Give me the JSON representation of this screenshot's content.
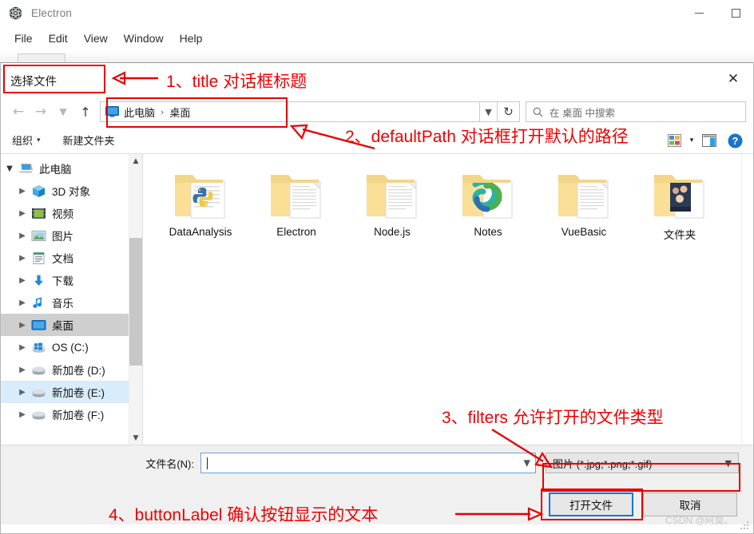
{
  "host_window": {
    "title": "Electron",
    "logo_icon": "electron-atom-icon",
    "menu": [
      {
        "label": "File"
      },
      {
        "label": "Edit"
      },
      {
        "label": "View"
      },
      {
        "label": "Window"
      },
      {
        "label": "Help"
      }
    ],
    "controls": {
      "minimize_icon": "minimize-icon",
      "maximize_icon": "maximize-icon"
    }
  },
  "dialog": {
    "title": "选择文件",
    "close_icon": "close-icon",
    "nav": {
      "back_icon": "arrow-left-icon",
      "forward_icon": "arrow-right-icon",
      "recent_icon": "chevron-down-icon",
      "up_icon": "arrow-up-icon",
      "breadcrumb_icon": "desktop-monitor-icon",
      "breadcrumb": [
        "此电脑",
        "桌面"
      ],
      "breadcrumb_separator": "›",
      "dropdown_icon": "chevron-down-icon",
      "refresh_icon": "refresh-icon",
      "search": {
        "icon": "search-icon",
        "placeholder": "在 桌面 中搜索",
        "value": ""
      }
    },
    "toolbar": {
      "organize_label": "组织",
      "organize_caret": "▾",
      "new_folder_label": "新建文件夹",
      "view_icon": "view-layout-icon",
      "view_caret": "▾",
      "preview_pane_icon": "preview-pane-icon",
      "help_icon": "help-question-icon"
    },
    "sidebar": {
      "items": [
        {
          "label": "此电脑",
          "icon": "computer-icon",
          "level": 1,
          "expander": "chevron-down-icon",
          "state": "normal"
        },
        {
          "label": "3D 对象",
          "icon": "cube-3d-icon",
          "level": 2,
          "expander": "chevron-right-icon",
          "state": "normal"
        },
        {
          "label": "视频",
          "icon": "videos-icon",
          "level": 2,
          "expander": "chevron-right-icon",
          "state": "normal"
        },
        {
          "label": "图片",
          "icon": "pictures-icon",
          "level": 2,
          "expander": "chevron-right-icon",
          "state": "normal"
        },
        {
          "label": "文档",
          "icon": "documents-icon",
          "level": 2,
          "expander": "chevron-right-icon",
          "state": "normal"
        },
        {
          "label": "下载",
          "icon": "downloads-icon",
          "level": 2,
          "expander": "chevron-right-icon",
          "state": "normal"
        },
        {
          "label": "音乐",
          "icon": "music-icon",
          "level": 2,
          "expander": "chevron-right-icon",
          "state": "normal"
        },
        {
          "label": "桌面",
          "icon": "desktop-icon",
          "level": 2,
          "expander": "chevron-right-icon",
          "state": "selected"
        },
        {
          "label": "OS (C:)",
          "icon": "windows-drive-icon",
          "level": 2,
          "expander": "chevron-right-icon",
          "state": "normal"
        },
        {
          "label": "新加卷 (D:)",
          "icon": "drive-icon",
          "level": 2,
          "expander": "chevron-right-icon",
          "state": "normal"
        },
        {
          "label": "新加卷 (E:)",
          "icon": "drive-icon",
          "level": 2,
          "expander": "chevron-right-icon",
          "state": "highlight"
        },
        {
          "label": "新加卷 (F:)",
          "icon": "drive-icon",
          "level": 2,
          "expander": "chevron-right-icon",
          "state": "normal"
        }
      ],
      "scrollbar": {
        "up_icon": "scroll-up-icon",
        "down_icon": "scroll-down-icon"
      }
    },
    "files": [
      {
        "label": "DataAnalysis",
        "icon": "folder-python-icon"
      },
      {
        "label": "Electron",
        "icon": "folder-document-icon"
      },
      {
        "label": "Node.js",
        "icon": "folder-document-icon"
      },
      {
        "label": "Notes",
        "icon": "folder-onenote-icon"
      },
      {
        "label": "VueBasic",
        "icon": "folder-document-icon"
      },
      {
        "label": "文件夹",
        "icon": "folder-photo-icon"
      }
    ],
    "footer": {
      "filename_label": "文件名(N):",
      "filename_value": "",
      "filename_placeholder": "",
      "filename_caret_icon": "chevron-down-icon",
      "filter_value": "图片 (*.jpg;*.png;*.gif)",
      "filter_caret_icon": "chevron-down-icon",
      "open_button": "打开文件",
      "cancel_button": "取消",
      "resize_grip_icon": "resize-grip-icon"
    }
  },
  "annotations": [
    {
      "id": 1,
      "text": "1、title 对话框标题"
    },
    {
      "id": 2,
      "text": "2、defaultPath 对话框打开默认的路径"
    },
    {
      "id": 3,
      "text": "3、filters 允许打开的文件类型"
    },
    {
      "id": 4,
      "text": "4、buttonLabel 确认按钮显示的文本"
    }
  ],
  "watermark": "CSDN @阿莫、",
  "colors": {
    "annotation_red": "#ee0000",
    "accent_blue": "#0078d7",
    "selection_gray": "#cfcfcf",
    "highlight_blue": "#d9ecfb",
    "folder_yellow": "#fbdf97"
  }
}
